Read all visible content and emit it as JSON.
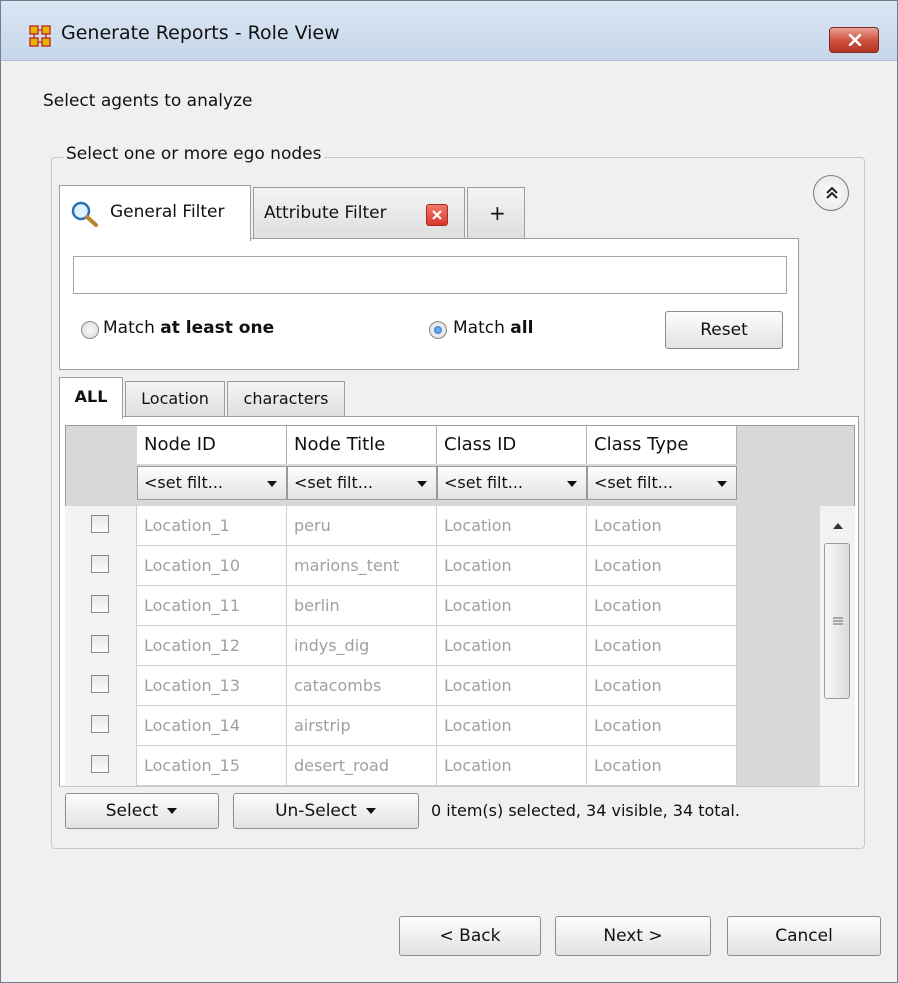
{
  "window": {
    "title": "Generate Reports - Role View",
    "icon": "network-grid-icon",
    "close_icon": "close-icon"
  },
  "prompt": "Select agents to analyze",
  "group": {
    "label": "Select one or more ego nodes",
    "collapse_icon": "double-chevron-up-icon"
  },
  "filter_tabs": {
    "general": "General Filter",
    "attribute": "Attribute Filter",
    "add": "+"
  },
  "filter": {
    "input_value": "",
    "match_one_prefix": "Match ",
    "match_one_bold": "at least one",
    "match_all_prefix": "Match ",
    "match_all_bold": "all",
    "selected_mode": "all",
    "reset_label": "Reset"
  },
  "data_tabs": [
    "ALL",
    "Location",
    "characters"
  ],
  "table": {
    "columns": [
      "Node ID",
      "Node Title",
      "Class ID",
      "Class Type"
    ],
    "filter_placeholder": "<set filt...",
    "rows": [
      [
        "Location_1",
        "peru",
        "Location",
        "Location"
      ],
      [
        "Location_10",
        "marions_tent",
        "Location",
        "Location"
      ],
      [
        "Location_11",
        "berlin",
        "Location",
        "Location"
      ],
      [
        "Location_12",
        "indys_dig",
        "Location",
        "Location"
      ],
      [
        "Location_13",
        "catacombs",
        "Location",
        "Location"
      ],
      [
        "Location_14",
        "airstrip",
        "Location",
        "Location"
      ],
      [
        "Location_15",
        "desert_road",
        "Location",
        "Location"
      ]
    ]
  },
  "bottom": {
    "select_label": "Select",
    "unselect_label": "Un-Select",
    "status": "0 item(s) selected, 34 visible, 34 total."
  },
  "nav": {
    "back": "< Back",
    "next": "Next >",
    "cancel": "Cancel"
  },
  "colors": {
    "titlebar": "#c6d6ea",
    "close": "#cd4d3b",
    "row_text_disabled": "#a0a0a0"
  }
}
